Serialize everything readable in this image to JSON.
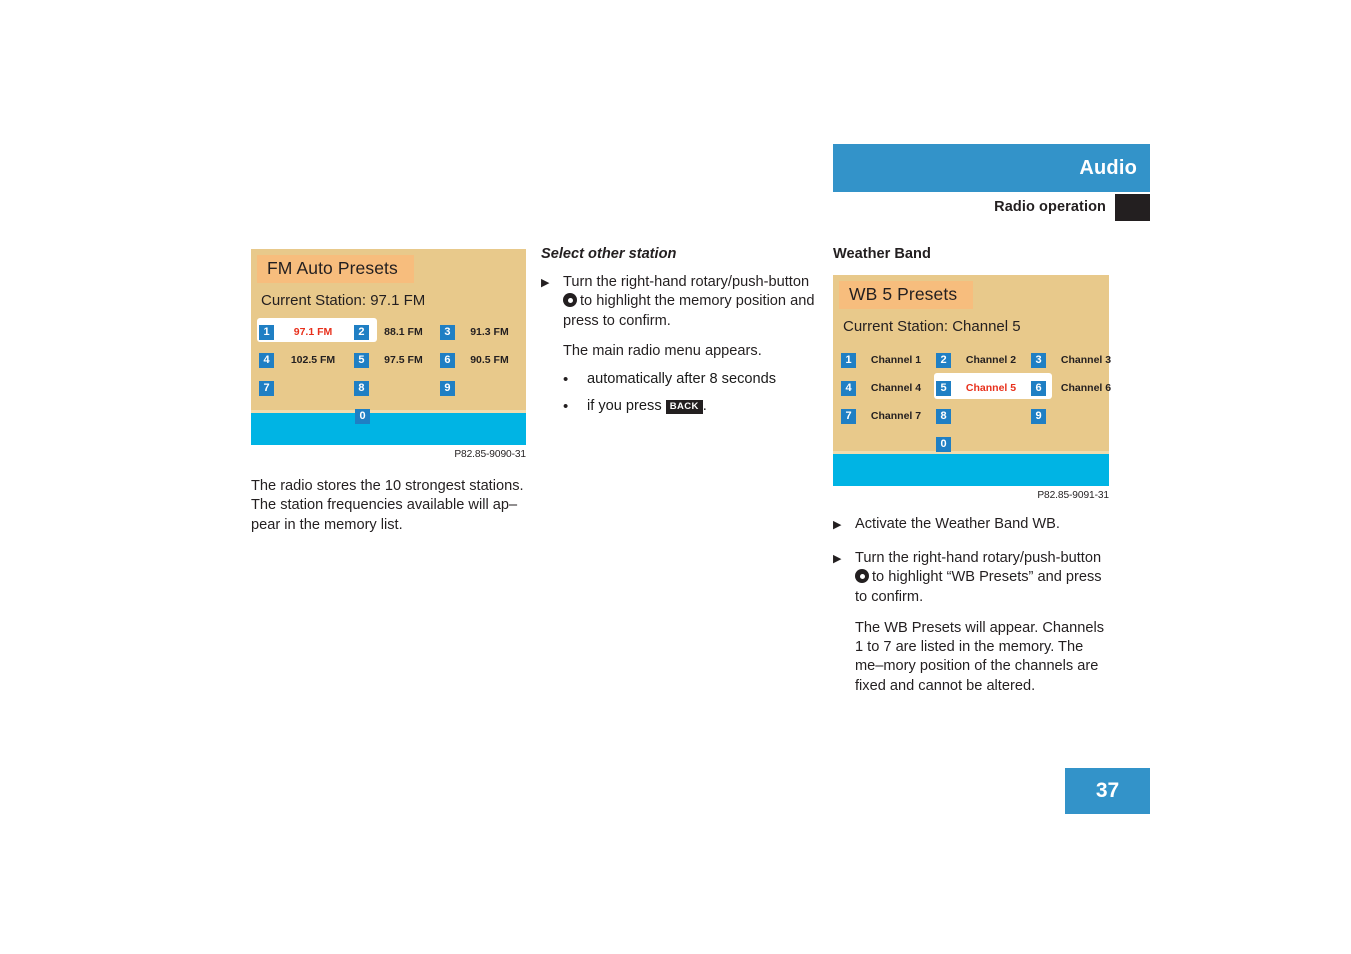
{
  "header": {
    "title": "Audio",
    "subtitle": "Radio operation",
    "bar_color": "#3393c9",
    "square_color": "#231f20"
  },
  "page_number": "37",
  "left_column": {
    "screen": {
      "title": "FM Auto Presets",
      "current_station_label": "Current Station: 97.1 FM",
      "rows": [
        [
          {
            "num": "1",
            "value": "97.1 FM",
            "selected": true
          },
          {
            "num": "2",
            "value": "88.1 FM",
            "selected": false
          },
          {
            "num": "3",
            "value": "91.3 FM",
            "selected": false
          }
        ],
        [
          {
            "num": "4",
            "value": "102.5 FM",
            "selected": false
          },
          {
            "num": "5",
            "value": "97.5 FM",
            "selected": false
          },
          {
            "num": "6",
            "value": "90.5 FM",
            "selected": false
          }
        ],
        [
          {
            "num": "7",
            "value": "",
            "selected": false
          },
          {
            "num": "8",
            "value": "",
            "selected": false
          },
          {
            "num": "9",
            "value": "",
            "selected": false
          }
        ],
        [
          {
            "num": "0",
            "value": "",
            "selected": false
          }
        ]
      ]
    },
    "figure_code": "P82.85-9090-31",
    "caption": "The radio stores the 10 strongest stations. The station frequencies available will ap–pear in the memory list."
  },
  "middle_column": {
    "section_title": "Select other station",
    "step_1_part_1": "Turn the right-hand rotary/push-button",
    "step_1_part_2": "to highlight the memory position and press to confirm.",
    "result_text": "The main radio menu appears.",
    "bullets": [
      {
        "text_before": "automatically after 8 seconds",
        "key": "",
        "text_after": ""
      },
      {
        "text_before": "if you press ",
        "key": "BACK",
        "text_after": "."
      }
    ],
    "marker": "▶",
    "bullet_glyph": "•",
    "knob_icon": "rotary-push-button-icon"
  },
  "right_column": {
    "section_title": "Weather Band",
    "screen": {
      "title": "WB 5 Presets",
      "current_station_label": "Current Station: Channel 5",
      "rows": [
        [
          {
            "num": "1",
            "value": "Channel 1",
            "selected": false
          },
          {
            "num": "2",
            "value": "Channel 2",
            "selected": false
          },
          {
            "num": "3",
            "value": "Channel 3",
            "selected": false
          }
        ],
        [
          {
            "num": "4",
            "value": "Channel 4",
            "selected": false
          },
          {
            "num": "5",
            "value": "Channel 5",
            "selected": true
          },
          {
            "num": "6",
            "value": "Channel 6",
            "selected": false
          }
        ],
        [
          {
            "num": "7",
            "value": "Channel 7",
            "selected": false
          },
          {
            "num": "8",
            "value": "",
            "selected": false
          },
          {
            "num": "9",
            "value": "",
            "selected": false
          }
        ],
        [
          {
            "num": "0",
            "value": "",
            "selected": false
          }
        ]
      ]
    },
    "figure_code": "P82.85-9091-31",
    "step_1": "Activate the Weather Band WB.",
    "step_2_part_1": "Turn the right-hand rotary/push-button",
    "step_2_part_2": "to highlight “WB Presets” and press to confirm.",
    "result_text": "The WB Presets will appear. Channels 1 to 7 are listed in the memory. The me–mory position of the channels are fixed and cannot be altered.",
    "marker": "▶"
  },
  "colors": {
    "screen_bg": "#e8c98b",
    "screen_title_bg": "#f7bd7d",
    "preset_button": "#1f7fc4",
    "selected_text": "#e8301c",
    "bottom_bar": "#00b4e4",
    "accent_blue": "#3393c9"
  }
}
